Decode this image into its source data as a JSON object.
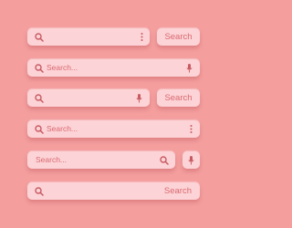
{
  "colors": {
    "background": "#f49e9e",
    "field": "#fcd3d6",
    "accent": "#d96a72"
  },
  "row1": {
    "button": "Search"
  },
  "row2": {
    "placeholder": "Search..."
  },
  "row3": {
    "button": "Search"
  },
  "row4": {
    "placeholder": "Search..."
  },
  "row5": {
    "placeholder": "Search..."
  },
  "row6": {
    "button": "Search"
  }
}
